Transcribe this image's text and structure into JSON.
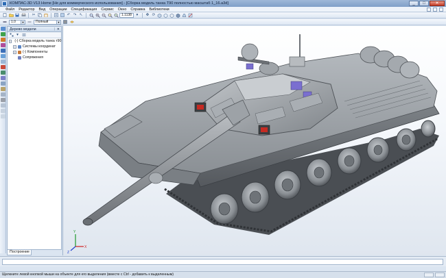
{
  "window": {
    "title": "КОМПАС-3D V13 Home [Не для коммерческого использования] - [Сборка модель танка Т90 полностью масштаб 1_16.a3d]",
    "controls": {
      "minimize": "_",
      "maximize": "□",
      "close": "✕"
    }
  },
  "menu": {
    "items": [
      "Файл",
      "Редактор",
      "Вид",
      "Операции",
      "Спецификация",
      "Сервис",
      "Окно",
      "Справка",
      "Библиотеки"
    ]
  },
  "toolbar": {
    "zoom_value": "1.1138"
  },
  "propbar": {
    "line_width": "1.0",
    "line_style": "Полный"
  },
  "tree": {
    "title": "Дерево модели",
    "rows": [
      {
        "label": "(-) Сборка модель танка т90 с",
        "expander": "−",
        "level": 0
      },
      {
        "label": "Системы координат",
        "expander": "+",
        "level": 1
      },
      {
        "label": "(-) Компоненты",
        "expander": "+",
        "level": 1
      },
      {
        "label": "Сопряжения",
        "expander": "",
        "level": 1
      }
    ],
    "tab_label": "Построение"
  },
  "axes": {
    "x": "X",
    "y": "Y",
    "z": "Z"
  },
  "status": {
    "hint": "Щелкните левой кнопкой мыши на объекте для его выделения (вместе с Ctrl - добавить к выделенным)"
  },
  "colors": {
    "title_gradient": "#7f9fc8",
    "tank_body": "#8e9398",
    "tank_dark": "#55595e",
    "accent_red": "#c62a22",
    "accent_purple": "#7a6fd0",
    "axis_x": "#d02020",
    "axis_y": "#1e9a2a",
    "axis_z": "#1f3fd0"
  }
}
